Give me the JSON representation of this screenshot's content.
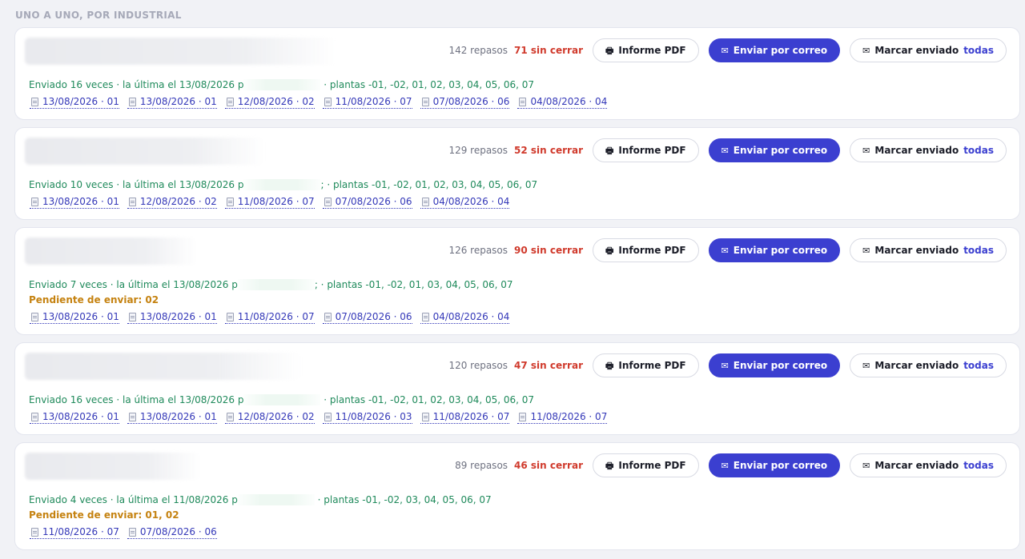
{
  "section_title": "UNO A UNO, POR INDUSTRIAL",
  "buttons": {
    "pdf": "Informe PDF",
    "mail": "Enviar por correo",
    "mark": "Marcar enviado",
    "mark_all": "todas"
  },
  "icons": {
    "pdf": "printer-icon",
    "mail": "envelope-icon",
    "doc": "document-icon"
  },
  "colors": {
    "accent": "#3b3fd0",
    "open": "#d03a2c",
    "sent": "#1f8a5b",
    "pending": "#c58210"
  },
  "cards": [
    {
      "repasos": "142 repasos",
      "sin_cerrar": "71 sin cerrar",
      "status_pre": "Enviado 16 veces · la última el 13/08/2026 p",
      "status_post": " · plantas -01, -02, 01, 02, 03, 04, 05, 06, 07",
      "pending": "",
      "links": [
        "13/08/2026 · 01",
        "13/08/2026 · 01",
        "12/08/2026 · 02",
        "11/08/2026 · 07",
        "07/08/2026 · 06",
        "04/08/2026 · 04"
      ]
    },
    {
      "repasos": "129 repasos",
      "sin_cerrar": "52 sin cerrar",
      "status_pre": "Enviado 10 veces · la última el 13/08/2026 p",
      "status_post": "; · plantas -01, -02, 01, 02, 03, 04, 05, 06, 07",
      "pending": "",
      "links": [
        "13/08/2026 · 01",
        "12/08/2026 · 02",
        "11/08/2026 · 07",
        "07/08/2026 · 06",
        "04/08/2026 · 04"
      ]
    },
    {
      "repasos": "126 repasos",
      "sin_cerrar": "90 sin cerrar",
      "status_pre": "Enviado 7 veces · la última el 13/08/2026 p",
      "status_post": "; · plantas -01, -02, 01, 03, 04, 05, 06, 07",
      "pending": "Pendiente de enviar: 02",
      "links": [
        "13/08/2026 · 01",
        "13/08/2026 · 01",
        "11/08/2026 · 07",
        "07/08/2026 · 06",
        "04/08/2026 · 04"
      ]
    },
    {
      "repasos": "120 repasos",
      "sin_cerrar": "47 sin cerrar",
      "status_pre": "Enviado 16 veces · la última el 13/08/2026 p",
      "status_post": " · plantas -01, -02, 01, 02, 03, 04, 05, 06, 07",
      "pending": "",
      "links": [
        "13/08/2026 · 01",
        "13/08/2026 · 01",
        "12/08/2026 · 02",
        "11/08/2026 · 03",
        "11/08/2026 · 07",
        "11/08/2026 · 07"
      ]
    },
    {
      "repasos": "89 repasos",
      "sin_cerrar": "46 sin cerrar",
      "status_pre": "Enviado 4 veces · la última el 11/08/2026 p",
      "status_post": " · plantas -01, -02, 03, 04, 05, 06, 07",
      "pending": "Pendiente de enviar: 01, 02",
      "links": [
        "11/08/2026 · 07",
        "07/08/2026 · 06"
      ]
    }
  ]
}
